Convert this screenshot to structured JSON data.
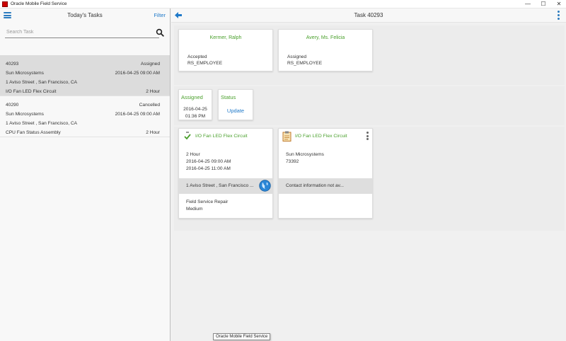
{
  "window": {
    "title": "Oracle Mobile Field Service",
    "controls": {
      "minimize": "—",
      "maximize": "☐",
      "close": "✕"
    }
  },
  "left_pane": {
    "title": "Today's Tasks",
    "filter_label": "Filter",
    "search": {
      "placeholder": "Search Task",
      "value": ""
    },
    "tasks": [
      {
        "id": "40293",
        "status": "Assigned",
        "company": "Sun Microsystems",
        "datetime": "2016-04-25 09:00 AM",
        "address": "1 Aviso Street , San Francisco, CA",
        "product": "I/O Fan LED Flex Circuit",
        "duration": "2 Hour",
        "selected": true
      },
      {
        "id": "40290",
        "status": "Cancelled",
        "company": "Sun Microsystems",
        "datetime": "2016-04-25 09:00 AM",
        "address": "1 Aviso Street , San Francisco, CA",
        "product": "CPU Fan Status Assembly",
        "duration": "2 Hour",
        "selected": false
      }
    ]
  },
  "right_pane": {
    "title": "Task 40293",
    "contacts": [
      {
        "name": "Kermer, Ralph",
        "status": "Accepted",
        "role": "RS_EMPLOYEE"
      },
      {
        "name": "Avery, Ms. Felicia",
        "status": "Assigned",
        "role": "RS_EMPLOYEE"
      }
    ],
    "status_cards": {
      "assigned": {
        "label": "Assigned",
        "date": "2016-04-25",
        "time": "01:36 PM"
      },
      "status": {
        "label": "Status",
        "action": "Update"
      }
    },
    "task_detail": {
      "title": "I/O Fan LED Flex Circuit",
      "duration": "2 Hour",
      "start": "2016-04-25 09:00 AM",
      "end": "2016-04-25 11:00 AM",
      "address": "1 Aviso Street , San Francisco ...",
      "type": "Field Service Repair",
      "priority": "Medium"
    },
    "customer_detail": {
      "title": "I/O Fan LED Flex Circuit",
      "company": "Sun Microsystems",
      "number": "73392",
      "contact": "Contact information not av..."
    }
  },
  "taskbar_tooltip": "Oracle Mobile Field Service",
  "colors": {
    "accent": "#1f79c9",
    "green": "#4aa02c",
    "selected_row": "#dcdcdc"
  },
  "icons": [
    "hamburger-menu-icon",
    "search-icon",
    "back-arrow-icon",
    "kebab-menu-icon",
    "checkmark-icon",
    "clipboard-icon",
    "globe-icon",
    "more-vertical-icon"
  ]
}
